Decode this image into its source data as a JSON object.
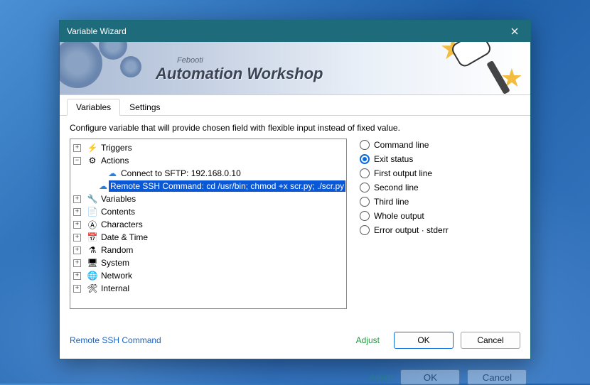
{
  "window": {
    "title": "Variable Wizard"
  },
  "banner": {
    "sub": "Febooti",
    "main": "Automation Workshop"
  },
  "tabs": {
    "variables": "Variables",
    "settings": "Settings"
  },
  "instruction": "Configure variable that will provide chosen field with flexible input instead of fixed value.",
  "tree": {
    "triggers": "Triggers",
    "actions": "Actions",
    "connect_sftp": "Connect to SFTP: 192.168.0.10",
    "remote_ssh": "Remote SSH Command: cd /usr/bin; chmod +x scr.py; ./scr.py",
    "variables": "Variables",
    "contents": "Contents",
    "characters": "Characters",
    "datetime": "Date & Time",
    "random": "Random",
    "system": "System",
    "network": "Network",
    "internal": "Internal"
  },
  "options": {
    "command_line": "Command line",
    "exit_status": "Exit status",
    "first_output": "First output line",
    "second_line": "Second line",
    "third_line": "Third line",
    "whole_output": "Whole output",
    "error_output": "Error output · stderr"
  },
  "footer": {
    "path": "Remote SSH Command",
    "adjust": "Adjust",
    "ok": "OK",
    "cancel": "Cancel"
  }
}
